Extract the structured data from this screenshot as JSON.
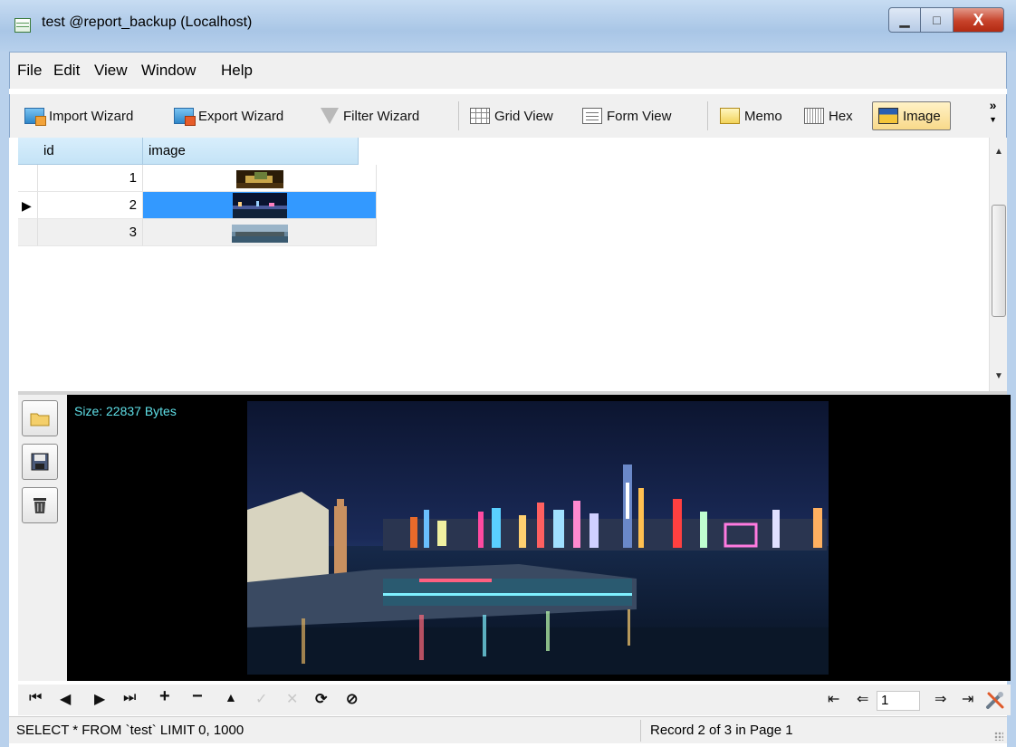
{
  "window": {
    "title": "test @report_backup (Localhost)",
    "min_glyph": "▁",
    "max_glyph": "□",
    "close_glyph": "X"
  },
  "menu": [
    "File",
    "Edit",
    "View",
    "Window",
    "Help"
  ],
  "toolbar": {
    "import_wizard": "Import Wizard",
    "export_wizard": "Export Wizard",
    "filter_wizard": "Filter Wizard",
    "grid_view": "Grid View",
    "form_view": "Form View",
    "memo": "Memo",
    "hex": "Hex",
    "image": "Image",
    "overflow": "»"
  },
  "grid": {
    "columns": [
      "id",
      "image"
    ],
    "rows": [
      {
        "id": "1",
        "selected": false
      },
      {
        "id": "2",
        "selected": true
      },
      {
        "id": "3",
        "selected": false
      }
    ],
    "current_row_marker": "▶"
  },
  "image_panel": {
    "size_text": "Size: 22837 Bytes"
  },
  "navigator": {
    "first": "⏮",
    "prev": "◀",
    "next": "▶",
    "last": "⏭",
    "add": "+",
    "delete": "−",
    "up": "▲",
    "apply": "✓",
    "cancel": "✕",
    "refresh": "⟳",
    "stop": "⊘",
    "page_first": "⇤",
    "page_prev": "⇐",
    "page_number": "1",
    "page_next": "⇒",
    "page_last": "⇥"
  },
  "status": {
    "query": "SELECT * FROM `test` LIMIT 0, 1000",
    "record": "Record 2 of 3 in Page 1"
  },
  "colors": {
    "selection": "#3399ff",
    "header": "#cde8f9",
    "size_text": "#5fe0e8"
  }
}
